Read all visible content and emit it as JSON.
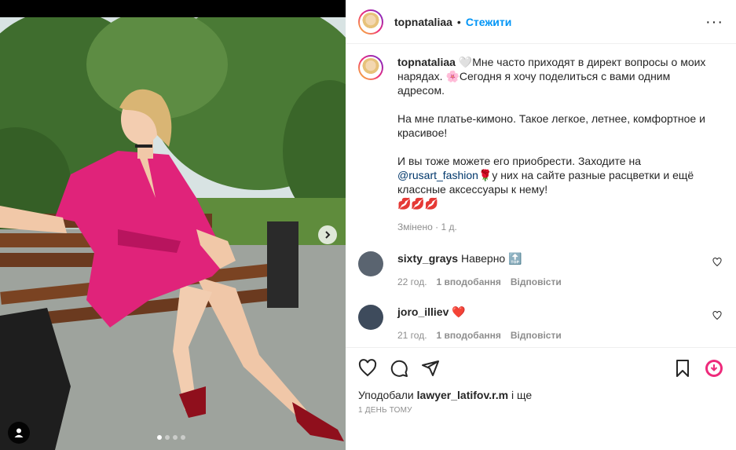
{
  "post": {
    "username": "topnataliaa",
    "separator": "•",
    "follow_label": "Стежити",
    "more_label": "···"
  },
  "caption": {
    "username": "topnataliaa",
    "line1": "🤍Мне часто приходят в директ вопросы о моих нарядах. 🌸Сегодня я хочу поделиться с вами одним адресом.",
    "line2": "На мне платье-кимоно. Такое легкое, летнее, комфортное и красивое!",
    "line3_pre": "И вы тоже можете его приобрести. Заходите на",
    "mention": "@rusart_fashion",
    "line3_post": "🌹у них на сайте разные расцветки и ещё классные аксессуары к нему!",
    "emojis": "💋💋💋",
    "edited": "Змінено",
    "edited_time": "1 д."
  },
  "comments": [
    {
      "username": "sixty_grays",
      "text": "Наверно 🔝",
      "time": "22 год.",
      "likes": "1 вподобання",
      "reply": "Відповісти",
      "avatar_color": "#5a6470"
    },
    {
      "username": "joro_illiev",
      "text": "❤️",
      "time": "21 год.",
      "likes": "1 вподобання",
      "reply": "Відповісти",
      "avatar_color": "#3e4b5c"
    }
  ],
  "liked_by": {
    "prefix": "Уподобали",
    "user": "lawyer_latifov.r.m",
    "suffix": "і ще"
  },
  "timestamp": "1 ДЕНЬ ТОМУ",
  "carousel": {
    "slides": 4,
    "active": 0
  },
  "colors": {
    "link": "#0095f6",
    "muted": "#8e8e8e",
    "dress": "#e0237a"
  },
  "icons": [
    "like-icon",
    "comment-icon",
    "share-icon",
    "bookmark-icon",
    "save-circle-icon"
  ]
}
